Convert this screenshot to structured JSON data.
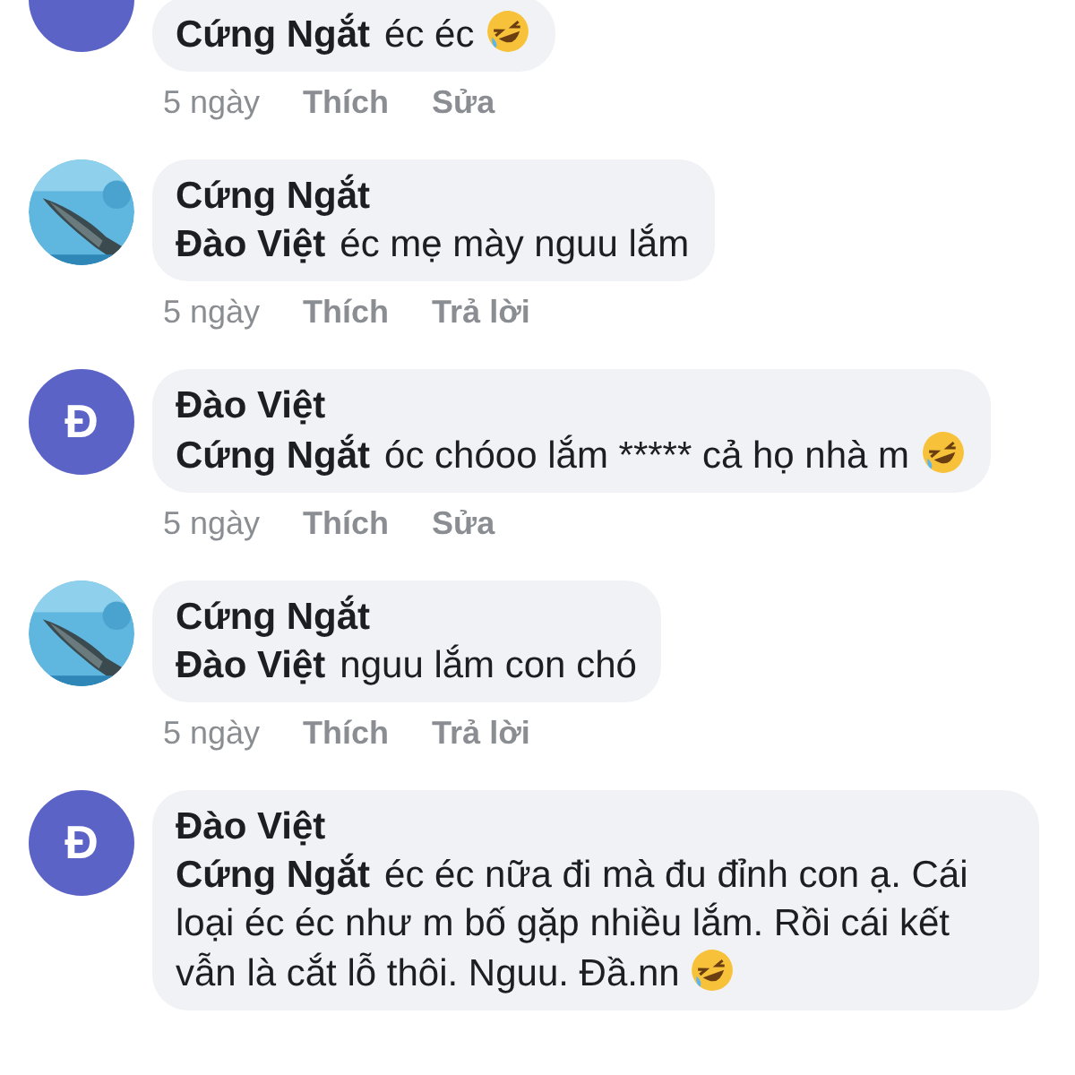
{
  "comments": [
    {
      "avatar": {
        "kind": "letter"
      },
      "mention": "Cứng Ngắt",
      "text": "éc éc",
      "emoji": true,
      "actions": [
        {
          "label": "5 ngày",
          "kind": "time"
        },
        {
          "label": "Thích",
          "kind": "action"
        },
        {
          "label": "Sửa",
          "kind": "action"
        }
      ]
    },
    {
      "author": "Cứng Ngắt",
      "mention": "Đào Việt",
      "text": "éc mẹ mày nguu lắm",
      "emoji": false,
      "actions": [
        {
          "label": "5 ngày",
          "kind": "time"
        },
        {
          "label": "Thích",
          "kind": "action"
        },
        {
          "label": "Trả lời",
          "kind": "action"
        }
      ]
    },
    {
      "avatar": {
        "kind": "letter",
        "letter": "Đ"
      },
      "author": "Đào Việt",
      "mention": "Cứng Ngắt",
      "text": "óc chóoo lắm ***** cả họ nhà m",
      "emoji": true,
      "actions": [
        {
          "label": "5 ngày",
          "kind": "time"
        },
        {
          "label": "Thích",
          "kind": "action"
        },
        {
          "label": "Sửa",
          "kind": "action"
        }
      ]
    },
    {
      "author": "Cứng Ngắt",
      "mention": "Đào Việt",
      "text": "nguu lắm con chó",
      "emoji": false,
      "actions": [
        {
          "label": "5 ngày",
          "kind": "time"
        },
        {
          "label": "Thích",
          "kind": "action"
        },
        {
          "label": "Trả lời",
          "kind": "action"
        }
      ]
    },
    {
      "avatar": {
        "kind": "letter",
        "letter": "Đ"
      },
      "author": "Đào Việt",
      "mention": "Cứng Ngắt",
      "text": "éc éc nữa đi mà đu đỉnh con ạ. Cái loại éc éc như m bố gặp nhiều lắm. Rồi cái kết vẫn là cắt lỗ thôi. Nguu. Đầ.nn",
      "emoji": true
    }
  ]
}
